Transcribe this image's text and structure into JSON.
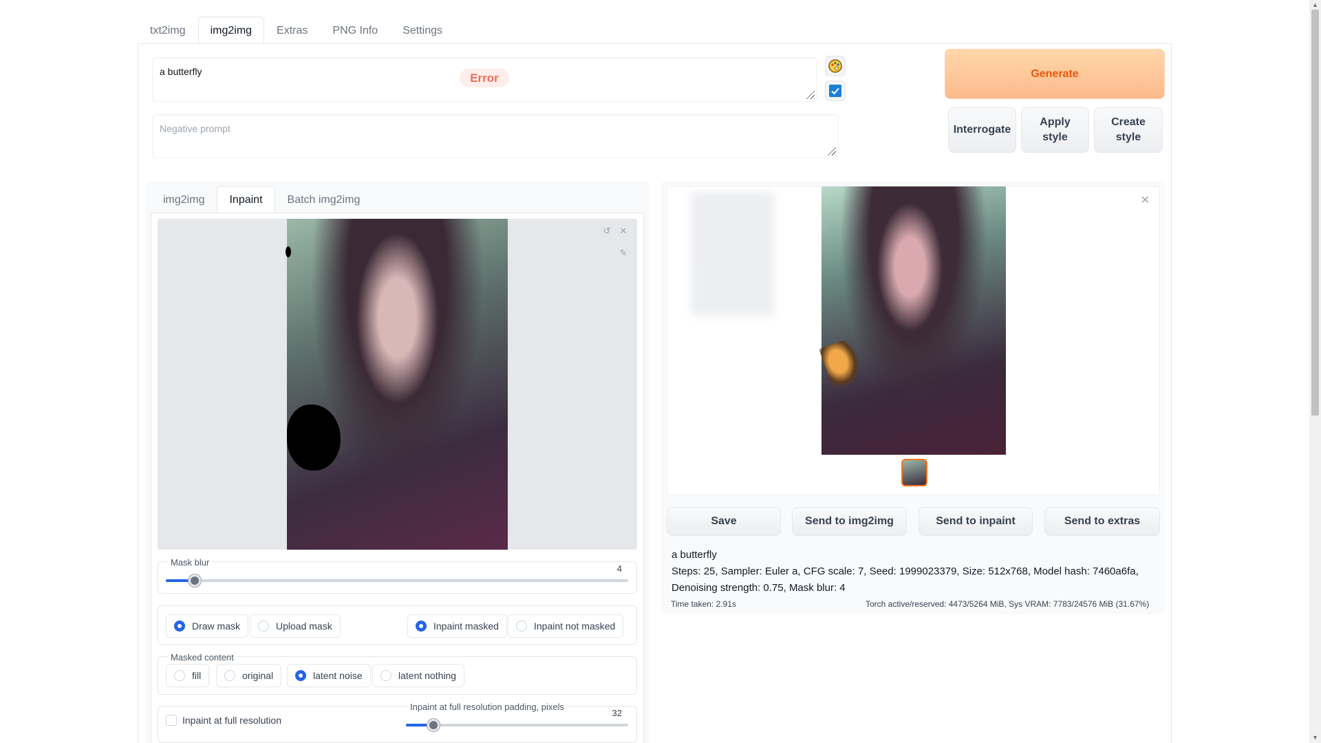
{
  "top_tabs": [
    "txt2img",
    "img2img",
    "Extras",
    "PNG Info",
    "Settings"
  ],
  "prompt": {
    "value": "a butterfly",
    "error": "Error"
  },
  "negative_prompt": {
    "placeholder": "Negative prompt"
  },
  "buttons": {
    "generate": "Generate",
    "interrogate": "Interrogate",
    "apply_style": "Apply style",
    "create_style": "Create style"
  },
  "sub_tabs": [
    "img2img",
    "Inpaint",
    "Batch img2img"
  ],
  "mask_blur": {
    "label": "Mask blur",
    "value": 4,
    "min": 0,
    "max": 64
  },
  "mask_mode": {
    "options": [
      "Draw mask",
      "Upload mask"
    ],
    "selected": "Draw mask"
  },
  "inpaint_mode": {
    "options": [
      "Inpaint masked",
      "Inpaint not masked"
    ],
    "selected": "Inpaint masked"
  },
  "masked_content": {
    "label": "Masked content",
    "options": [
      "fill",
      "original",
      "latent noise",
      "latent nothing"
    ],
    "selected": "latent noise"
  },
  "full_res": {
    "label": "Inpaint at full resolution",
    "checked": false
  },
  "padding": {
    "label": "Inpaint at full resolution padding, pixels",
    "value": 32,
    "min": 0,
    "max": 256
  },
  "actions": [
    "Save",
    "Send to img2img",
    "Send to inpaint",
    "Send to extras"
  ],
  "generation_info": {
    "prompt": "a butterfly",
    "params_line1": "Steps: 25, Sampler: Euler a, CFG scale: 7, Seed: 1999023379, Size: 512x768, Model hash: 7460a6fa,",
    "params_line2": "Denoising strength: 0.75, Mask blur: 4",
    "time_taken": "Time taken: 2.91s",
    "vram": "Torch active/reserved: 4473/5264 MiB, Sys VRAM: 7783/24576 MiB (31.67%)"
  },
  "icons": {
    "paint": "palette-icon",
    "check": "checkbox-icon",
    "undo": "undo-icon",
    "clear": "close-icon",
    "brush": "brush-icon",
    "gallery_close": "close-icon"
  },
  "colors": {
    "accent": "#2563eb",
    "generate_bg": "#fdba8c",
    "generate_text": "#ea580c",
    "error": "#ef6c5a"
  }
}
